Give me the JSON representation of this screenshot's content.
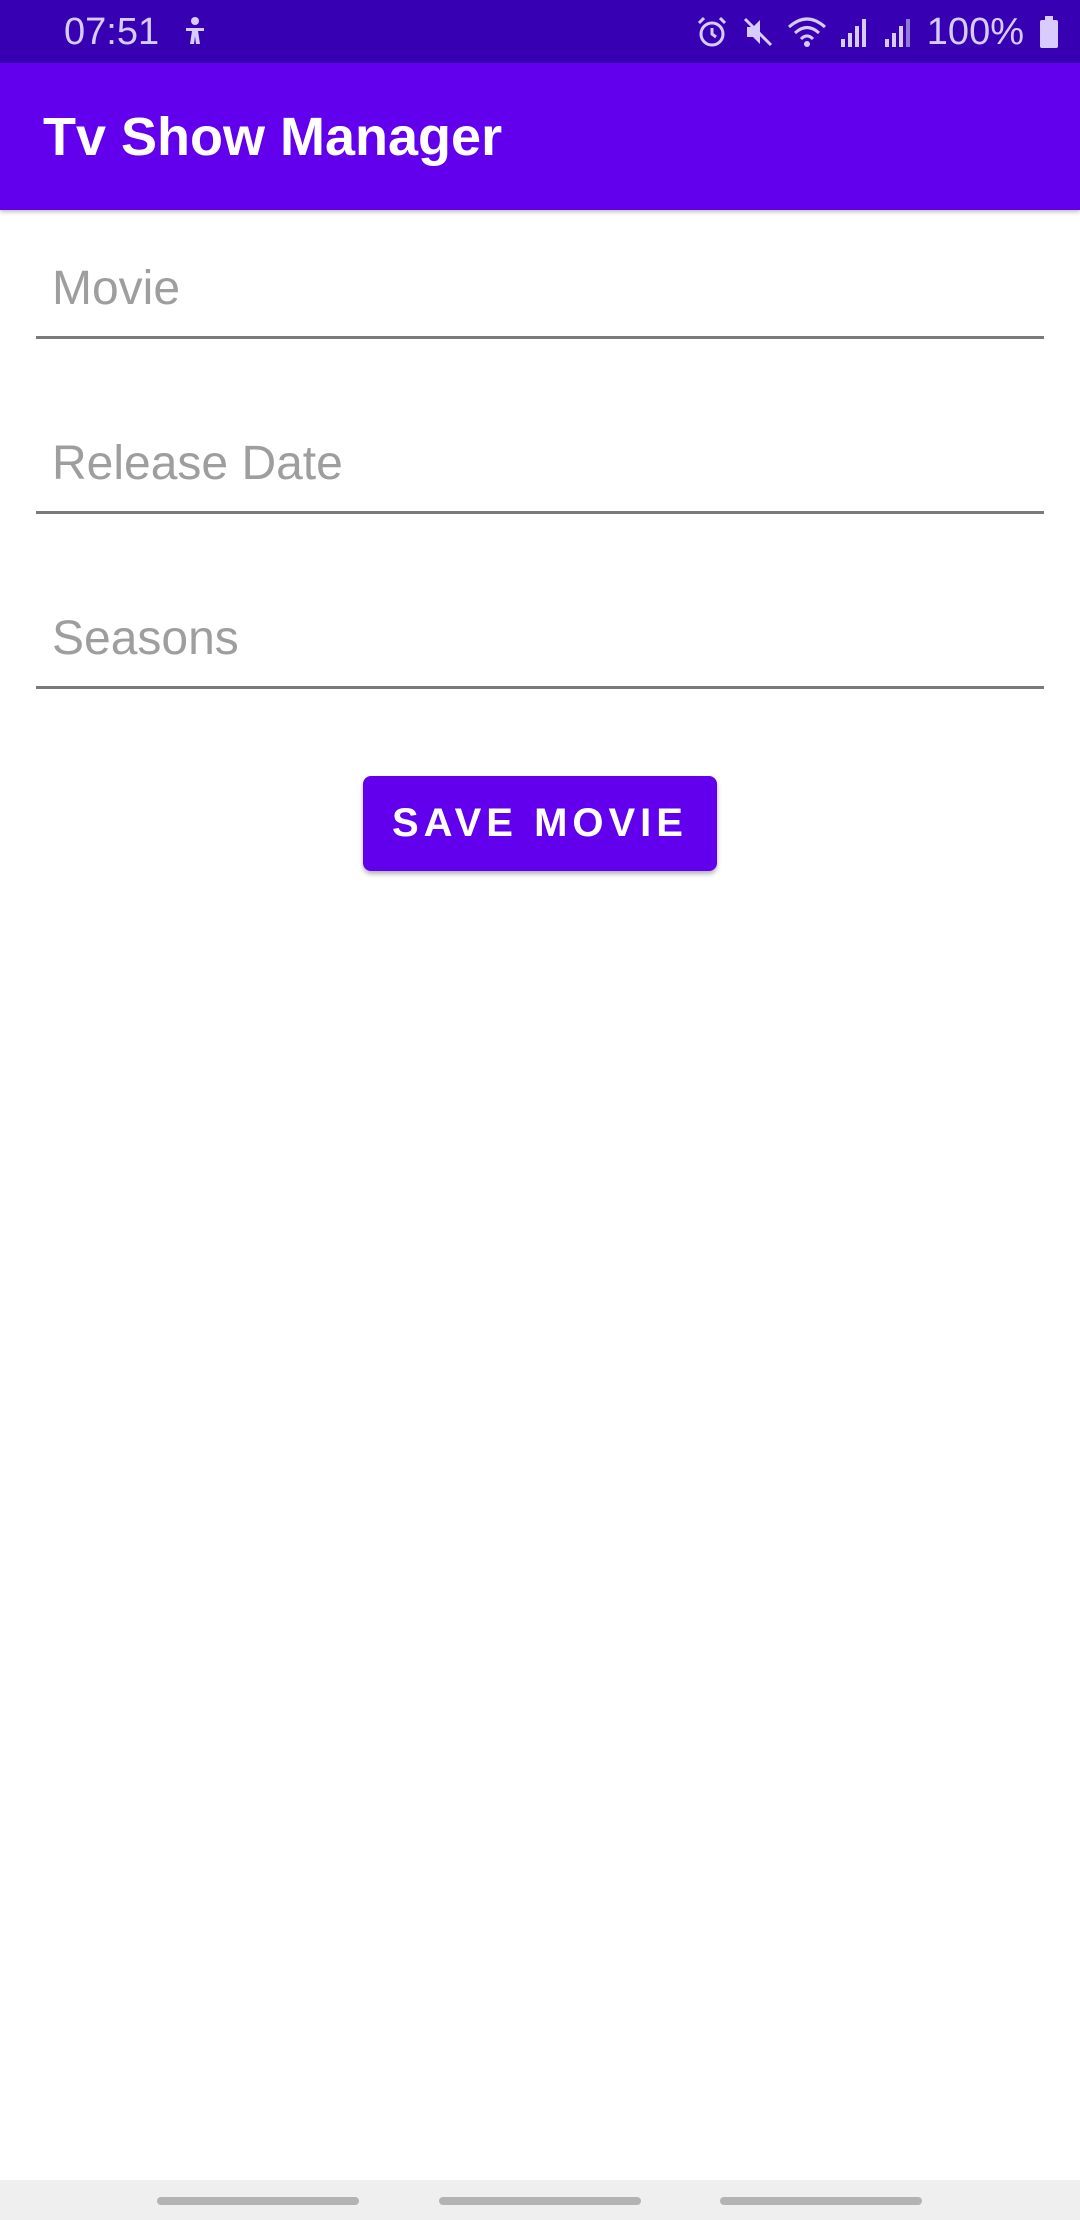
{
  "status_bar": {
    "time": "07:51",
    "notification_icon": "accessibility-icon",
    "icons": [
      "alarm-icon",
      "mute-icon",
      "wifi-icon",
      "signal-icon",
      "signal-icon",
      "battery-icon"
    ],
    "battery_text": "100%"
  },
  "app_bar": {
    "title": "Tv Show Manager"
  },
  "form": {
    "movie": {
      "value": "",
      "placeholder": "Movie"
    },
    "release_date": {
      "value": "",
      "placeholder": "Release Date"
    },
    "seasons": {
      "value": "",
      "placeholder": "Seasons"
    },
    "save_label": "SAVE MOVIE"
  },
  "colors": {
    "status_bar": "#3700b3",
    "primary": "#6200ee",
    "underline": "#7a7a7a",
    "placeholder": "#9e9e9e"
  }
}
